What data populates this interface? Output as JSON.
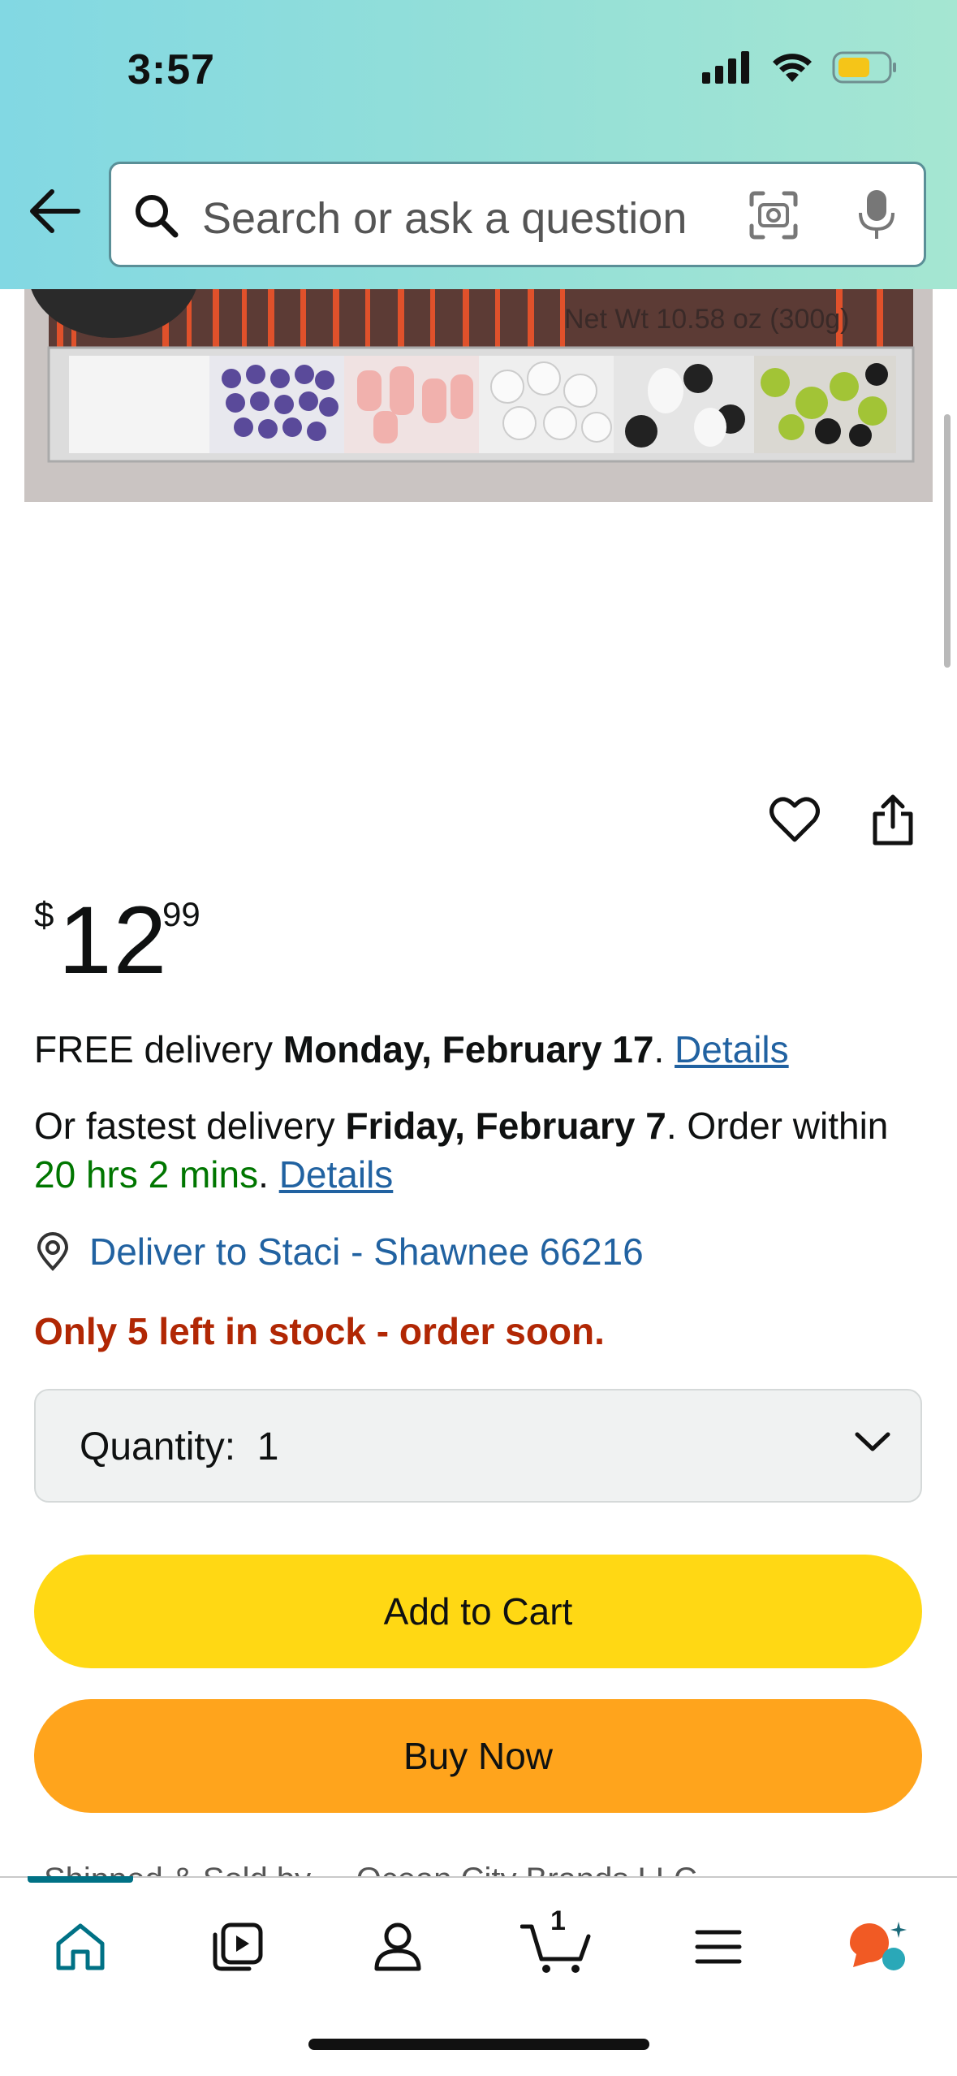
{
  "status_bar": {
    "time": "3:57"
  },
  "search": {
    "placeholder": "Search or ask a question"
  },
  "product_image": {
    "label": "Net Wt 10.58 oz (300g)"
  },
  "price": {
    "currency": "$",
    "whole": "12",
    "fraction": "99"
  },
  "delivery": {
    "free_prefix": "FREE delivery ",
    "free_date": "Monday, February 17",
    "free_suffix": ". ",
    "details_label": "Details",
    "fast_prefix": "Or fastest delivery ",
    "fast_date": "Friday, February 7",
    "fast_mid": ". Order within ",
    "fast_countdown": "20 hrs 2 mins",
    "fast_suffix": ". ",
    "deliver_to": "Deliver to Staci - Shawnee 66216"
  },
  "stock_message": "Only 5 left in stock - order soon.",
  "quantity": {
    "label": "Quantity:",
    "value": "1"
  },
  "buttons": {
    "add_to_cart": "Add to Cart",
    "buy_now": "Buy Now"
  },
  "sold_by": "Shipped & Sold by ... Ocean City Brands LLC",
  "bottom_nav": {
    "cart_count": "1"
  },
  "colors": {
    "link": "#2162a1",
    "stock": "#b12704",
    "green": "#007600",
    "add_to_cart": "#ffd814",
    "buy_now": "#ffa41c",
    "accent": "#007185"
  },
  "icons": [
    "back-arrow-icon",
    "search-icon",
    "camera-icon",
    "mic-icon",
    "heart-icon",
    "share-icon",
    "location-pin-icon",
    "chevron-down-icon",
    "home-icon",
    "video-icon",
    "account-icon",
    "cart-icon",
    "menu-icon",
    "rufus-icon"
  ]
}
